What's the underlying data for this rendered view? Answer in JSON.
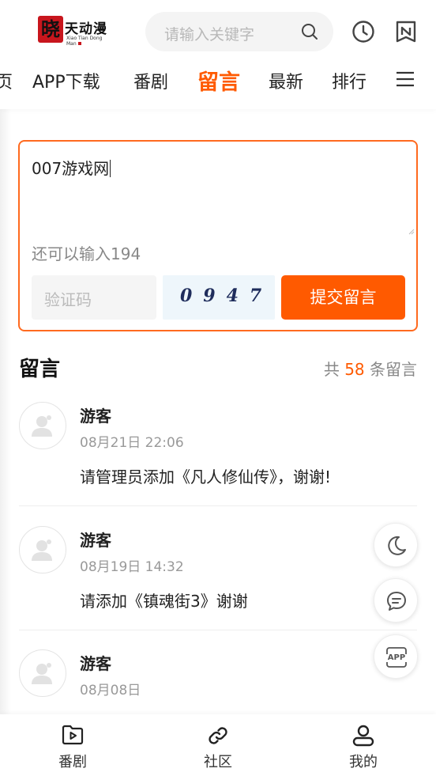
{
  "header": {
    "logo": {
      "mark": "晓",
      "title": "天动漫",
      "subtitle": "Xiao Tian Dong Man"
    },
    "search_placeholder": "请输入关键字",
    "icons": [
      "clock-icon",
      "bookmark-icon"
    ]
  },
  "nav": {
    "items": [
      {
        "label": "页"
      },
      {
        "label": "APP下载"
      },
      {
        "label": "番剧"
      },
      {
        "label": "留言",
        "active": true
      },
      {
        "label": "最新"
      },
      {
        "label": "排行"
      }
    ],
    "menu_icon": "hamburger-menu-icon"
  },
  "compose": {
    "text_value": "007游戏网",
    "remaining": "还可以输入194",
    "captcha_placeholder": "验证码",
    "captcha_code": "0947",
    "submit_label": "提交留言"
  },
  "comments_header": {
    "title": "留言",
    "count_prefix": "共",
    "count": "58",
    "count_suffix": "条留言"
  },
  "comments": [
    {
      "name": "游客",
      "time": "08月21日 22:06",
      "body": "请管理员添加《凡人修仙传》，谢谢!"
    },
    {
      "name": "游客",
      "time": "08月19日 14:32",
      "body": "请添加《镇魂街3》谢谢"
    },
    {
      "name": "游客",
      "time": "08月08日",
      "body": ""
    }
  ],
  "floating_buttons": [
    "moon-icon",
    "chat-icon",
    "app-icon"
  ],
  "floating_labels": {
    "app": "APP"
  },
  "bottom_tabs": [
    {
      "label": "番剧",
      "icon": "play-folder-icon"
    },
    {
      "label": "社区",
      "icon": "link-icon"
    },
    {
      "label": "我的",
      "icon": "user-icon"
    }
  ],
  "colors": {
    "accent": "#ff5a00",
    "border_accent": "#ff6a1f",
    "muted": "#999999"
  }
}
